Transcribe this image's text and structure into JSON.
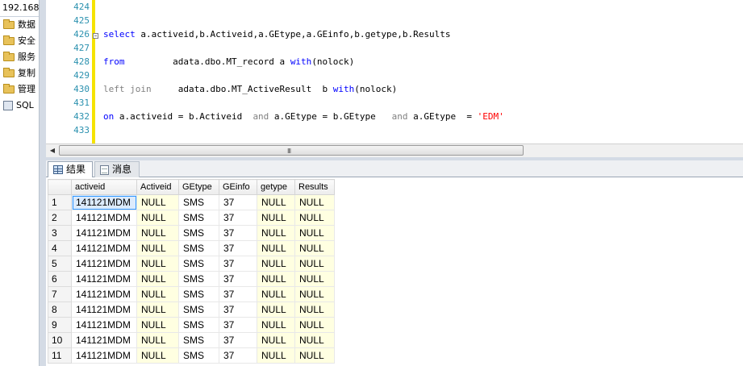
{
  "explorer": {
    "server": "192.168",
    "items": [
      {
        "label": "数据",
        "icon": "folder-icon"
      },
      {
        "label": "安全",
        "icon": "folder-icon"
      },
      {
        "label": "服务",
        "icon": "folder-icon"
      },
      {
        "label": "复制",
        "icon": "folder-icon"
      },
      {
        "label": "管理",
        "icon": "folder-icon"
      },
      {
        "label": "SQL",
        "icon": "sql-agent-icon"
      }
    ]
  },
  "editor": {
    "line_numbers": [
      "424",
      "425",
      "426",
      "427",
      "428",
      "429",
      "430",
      "431",
      "432",
      "433"
    ],
    "lines": [
      [],
      [],
      [
        {
          "t": "select",
          "c": "kw"
        },
        {
          "t": " a.activeid,b.Activeid,a.GEtype,a.GEinfo,b.getype,b.Results",
          "c": "tx"
        }
      ],
      [],
      [
        {
          "t": "from",
          "c": "kw"
        },
        {
          "t": "         adata.dbo.MT_record a ",
          "c": "tx"
        },
        {
          "t": "with",
          "c": "kw"
        },
        {
          "t": "(nolock)",
          "c": "tx"
        }
      ],
      [],
      [
        {
          "t": "left join",
          "c": "gr"
        },
        {
          "t": "     adata.dbo.MT_ActiveResult  b ",
          "c": "tx"
        },
        {
          "t": "with",
          "c": "kw"
        },
        {
          "t": "(nolock)",
          "c": "tx"
        }
      ],
      [],
      [
        {
          "t": "on",
          "c": "kw"
        },
        {
          "t": " a.activeid = b.Activeid  ",
          "c": "tx"
        },
        {
          "t": "and",
          "c": "gr"
        },
        {
          "t": " a.GEtype = b.GEtype   ",
          "c": "tx"
        },
        {
          "t": "and",
          "c": "gr"
        },
        {
          "t": " a.GEtype  = ",
          "c": "tx"
        },
        {
          "t": "'EDM'",
          "c": "str"
        }
      ],
      []
    ]
  },
  "scrollbar": {
    "grip": "III"
  },
  "tabs": {
    "results": "结果",
    "messages": "消息"
  },
  "grid": {
    "columns": [
      "activeid",
      "Activeid",
      "GEtype",
      "GEinfo",
      "getype",
      "Results"
    ],
    "rows": [
      [
        "1",
        "141121MDM",
        "NULL",
        "SMS",
        "37",
        "NULL",
        "NULL"
      ],
      [
        "2",
        "141121MDM",
        "NULL",
        "SMS",
        "37",
        "NULL",
        "NULL"
      ],
      [
        "3",
        "141121MDM",
        "NULL",
        "SMS",
        "37",
        "NULL",
        "NULL"
      ],
      [
        "4",
        "141121MDM",
        "NULL",
        "SMS",
        "37",
        "NULL",
        "NULL"
      ],
      [
        "5",
        "141121MDM",
        "NULL",
        "SMS",
        "37",
        "NULL",
        "NULL"
      ],
      [
        "6",
        "141121MDM",
        "NULL",
        "SMS",
        "37",
        "NULL",
        "NULL"
      ],
      [
        "7",
        "141121MDM",
        "NULL",
        "SMS",
        "37",
        "NULL",
        "NULL"
      ],
      [
        "8",
        "141121MDM",
        "NULL",
        "SMS",
        "37",
        "NULL",
        "NULL"
      ],
      [
        "9",
        "141121MDM",
        "NULL",
        "SMS",
        "37",
        "NULL",
        "NULL"
      ],
      [
        "10",
        "141121MDM",
        "NULL",
        "SMS",
        "37",
        "NULL",
        "NULL"
      ],
      [
        "11",
        "141121MDM",
        "NULL",
        "SMS",
        "37",
        "NULL",
        "NULL"
      ]
    ]
  }
}
